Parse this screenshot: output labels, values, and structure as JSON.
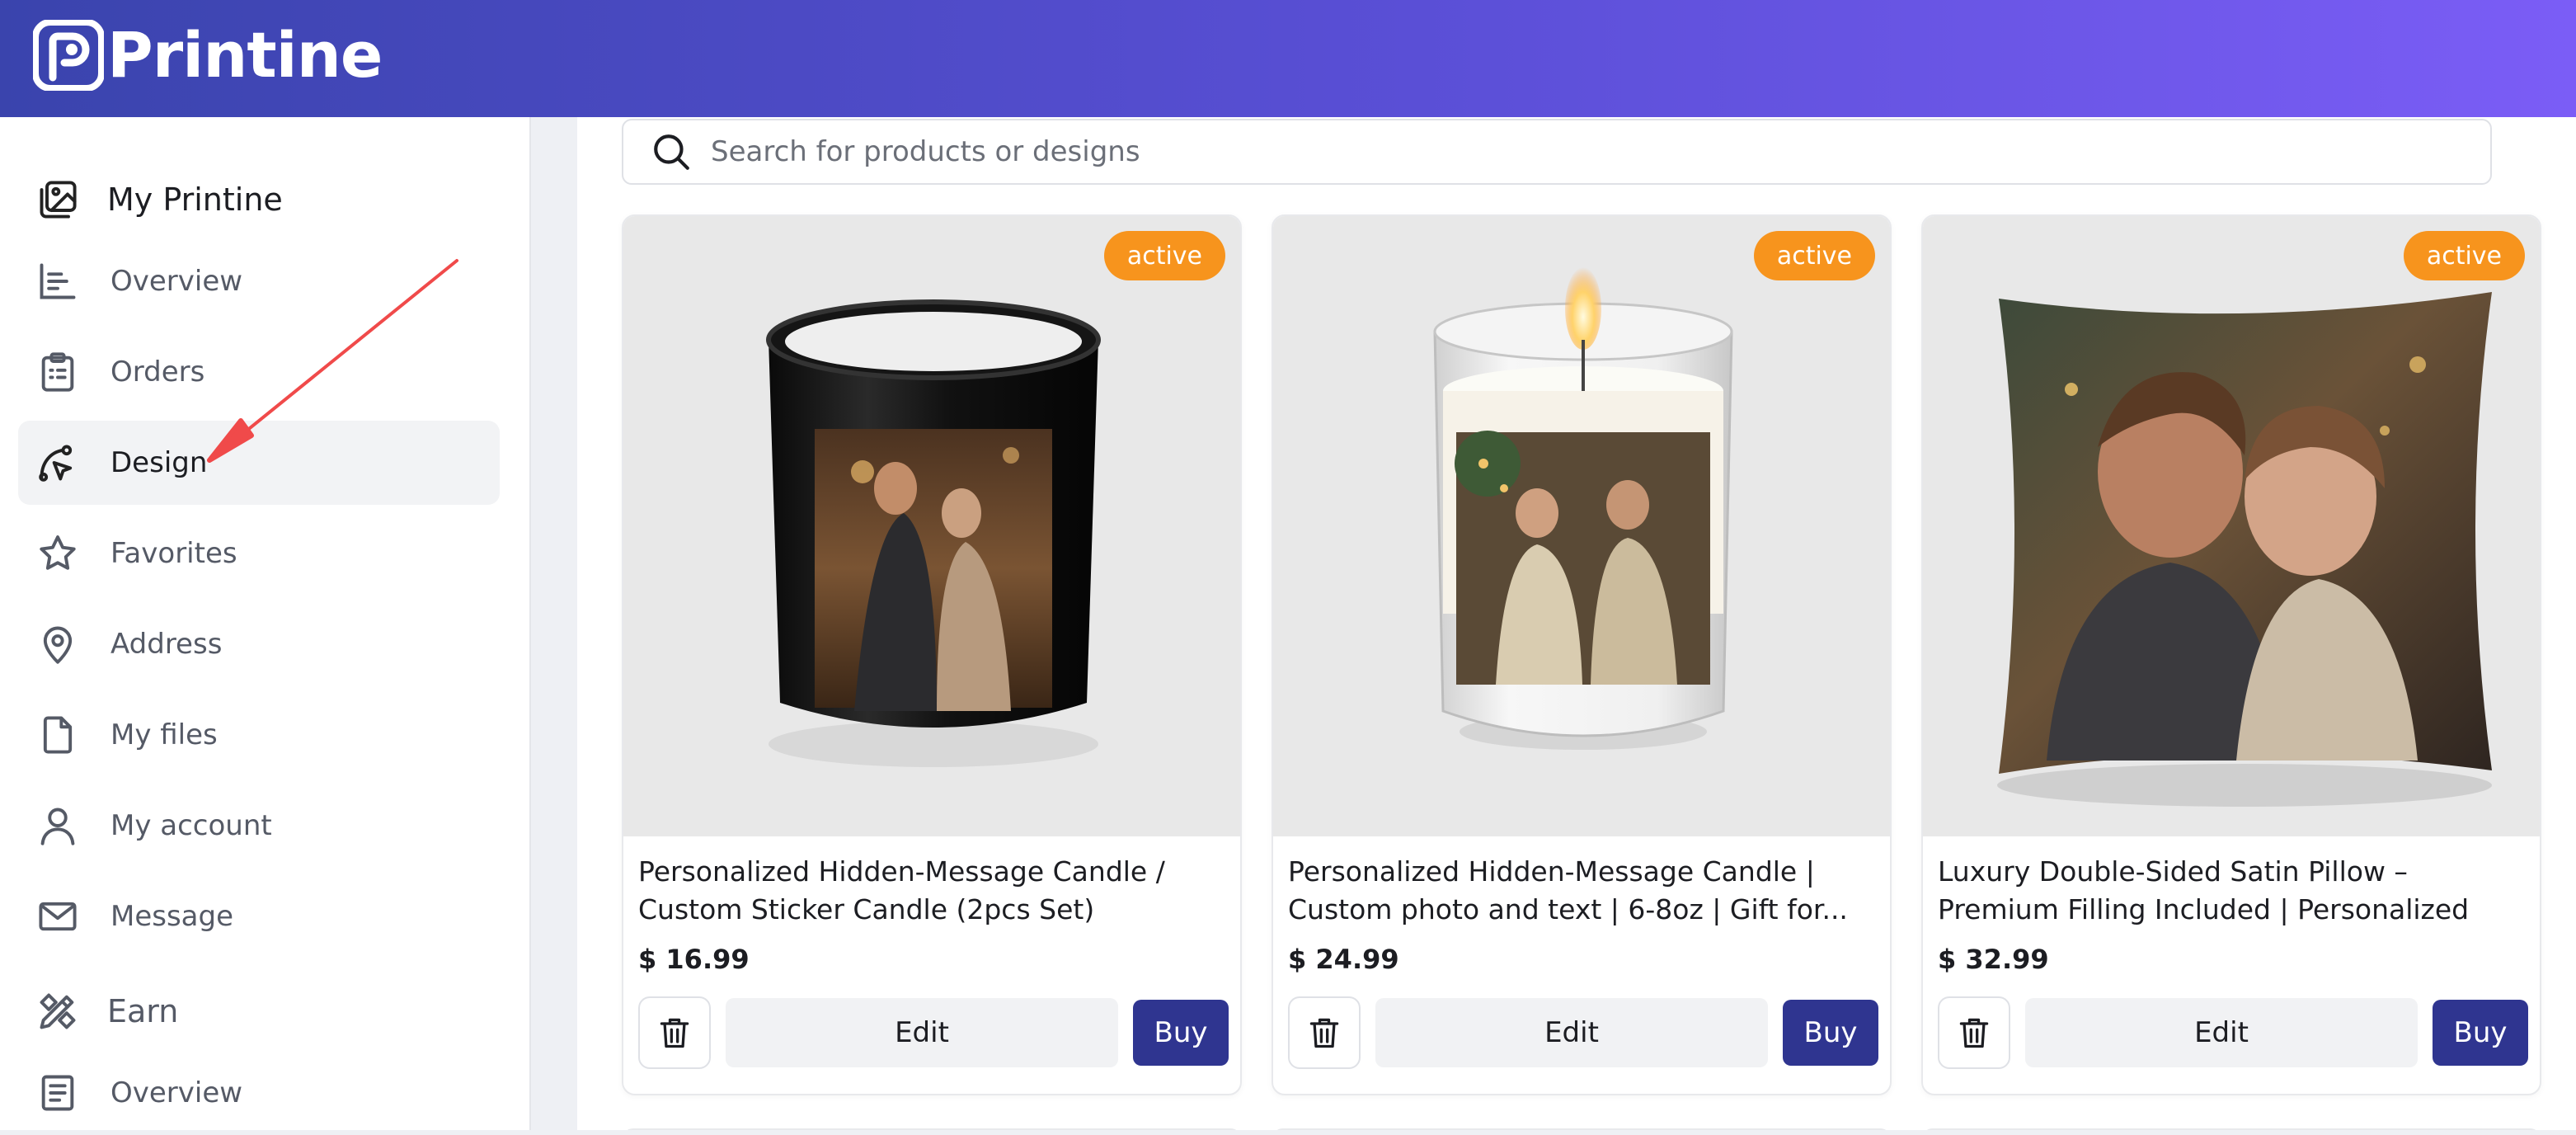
{
  "app": {
    "name": "Printine"
  },
  "sidebar": {
    "section_my": {
      "label": "My Printine",
      "icon": "image-gallery-icon"
    },
    "items": [
      {
        "label": "Overview",
        "icon": "chart-list-icon"
      },
      {
        "label": "Orders",
        "icon": "clipboard-icon"
      },
      {
        "label": "Design",
        "icon": "pen-curve-icon",
        "active": true
      },
      {
        "label": "Favorites",
        "icon": "star-icon"
      },
      {
        "label": "Address",
        "icon": "map-pin-icon"
      },
      {
        "label": "My files",
        "icon": "file-icon"
      },
      {
        "label": "My account",
        "icon": "user-icon"
      },
      {
        "label": "Message",
        "icon": "mail-icon"
      }
    ],
    "section_earn": {
      "label": "Earn",
      "icon": "pencil-ruler-icon"
    },
    "earn_items": [
      {
        "label": "Overview",
        "icon": "document-list-icon"
      }
    ]
  },
  "search": {
    "placeholder": "Search for products or designs"
  },
  "products": [
    {
      "status": "active",
      "title": "Personalized Hidden-Message Candle / Custom Sticker Candle (2pcs Set)",
      "price": "$ 16.99",
      "edit_label": "Edit",
      "buy_label": "Buy"
    },
    {
      "status": "active",
      "title": "Personalized Hidden-Message Candle | Custom photo and text | 6-8oz | Gift for...",
      "price": "$ 24.99",
      "edit_label": "Edit",
      "buy_label": "Buy"
    },
    {
      "status": "active",
      "title": "Luxury Double-Sided Satin Pillow – Premium Filling Included | Personalized",
      "price": "$ 32.99",
      "edit_label": "Edit",
      "buy_label": "Buy"
    }
  ],
  "colors": {
    "header_start": "#3a44ad",
    "header_end": "#7b5df6",
    "badge": "#f7941d",
    "buy_button": "#2f3590",
    "annotation_arrow": "#f04a4a"
  }
}
